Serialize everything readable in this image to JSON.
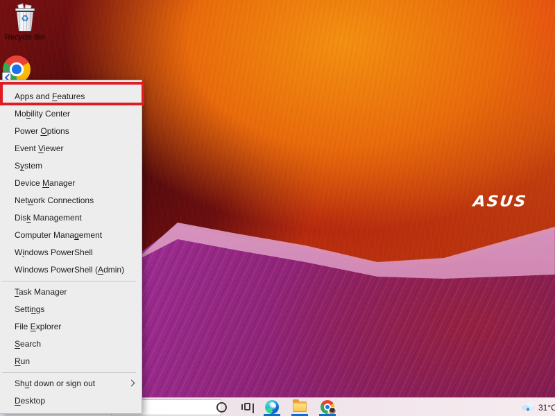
{
  "desktop": {
    "brand_logo": "ASUS",
    "icons": [
      {
        "name": "recycle-bin",
        "label": "Recycle Bin"
      },
      {
        "name": "google-chrome-shortcut",
        "label": ""
      }
    ],
    "wallpaper_colors": {
      "orange": "#ea6b0c",
      "dark_red": "#6d0e10",
      "magenta": "#9c2b90",
      "pink_highlight": "#dd9cc4"
    }
  },
  "winx_menu": {
    "highlight_color": "#df1c23",
    "items": [
      {
        "type": "item",
        "name": "apps-and-features",
        "pre": "Apps and ",
        "key": "F",
        "post": "eatures",
        "highlighted": true
      },
      {
        "type": "item",
        "name": "mobility-center",
        "pre": "Mo",
        "key": "b",
        "post": "ility Center"
      },
      {
        "type": "item",
        "name": "power-options",
        "pre": "Power ",
        "key": "O",
        "post": "ptions"
      },
      {
        "type": "item",
        "name": "event-viewer",
        "pre": "Event ",
        "key": "V",
        "post": "iewer"
      },
      {
        "type": "item",
        "name": "system",
        "pre": "S",
        "key": "y",
        "post": "stem"
      },
      {
        "type": "item",
        "name": "device-manager",
        "pre": "Device ",
        "key": "M",
        "post": "anager"
      },
      {
        "type": "item",
        "name": "network-connections",
        "pre": "Net",
        "key": "w",
        "post": "ork Connections"
      },
      {
        "type": "item",
        "name": "disk-management",
        "pre": "Dis",
        "key": "k",
        "post": " Management"
      },
      {
        "type": "item",
        "name": "computer-management",
        "pre": "Computer Mana",
        "key": "g",
        "post": "ement"
      },
      {
        "type": "item",
        "name": "windows-powershell",
        "pre": "W",
        "key": "i",
        "post": "ndows PowerShell"
      },
      {
        "type": "item",
        "name": "windows-powershell-admin",
        "pre": "Windows PowerShell (",
        "key": "A",
        "post": "dmin)"
      },
      {
        "type": "separator"
      },
      {
        "type": "item",
        "name": "task-manager",
        "pre": "",
        "key": "T",
        "post": "ask Manager"
      },
      {
        "type": "item",
        "name": "settings",
        "pre": "Setti",
        "key": "n",
        "post": "gs"
      },
      {
        "type": "item",
        "name": "file-explorer",
        "pre": "File ",
        "key": "E",
        "post": "xplorer"
      },
      {
        "type": "item",
        "name": "search",
        "pre": "",
        "key": "S",
        "post": "earch"
      },
      {
        "type": "item",
        "name": "run",
        "pre": "",
        "key": "R",
        "post": "un"
      },
      {
        "type": "separator"
      },
      {
        "type": "item",
        "name": "shut-down-or-sign-out",
        "pre": "Sh",
        "key": "u",
        "post": "t down or sign out",
        "submenu": true
      },
      {
        "type": "item",
        "name": "desktop",
        "pre": "",
        "key": "D",
        "post": "esktop"
      }
    ]
  },
  "taskbar": {
    "search_box": {
      "value": ""
    },
    "icons": [
      "cortana-circle",
      "task-view",
      "microsoft-edge",
      "file-explorer",
      "google-chrome"
    ],
    "running_apps": [
      "microsoft-edge",
      "file-explorer",
      "google-chrome"
    ],
    "accent_underline_color": "#0a6fd3",
    "weather": {
      "temp": "31°C",
      "condition_icon": "rain-cloud"
    }
  }
}
